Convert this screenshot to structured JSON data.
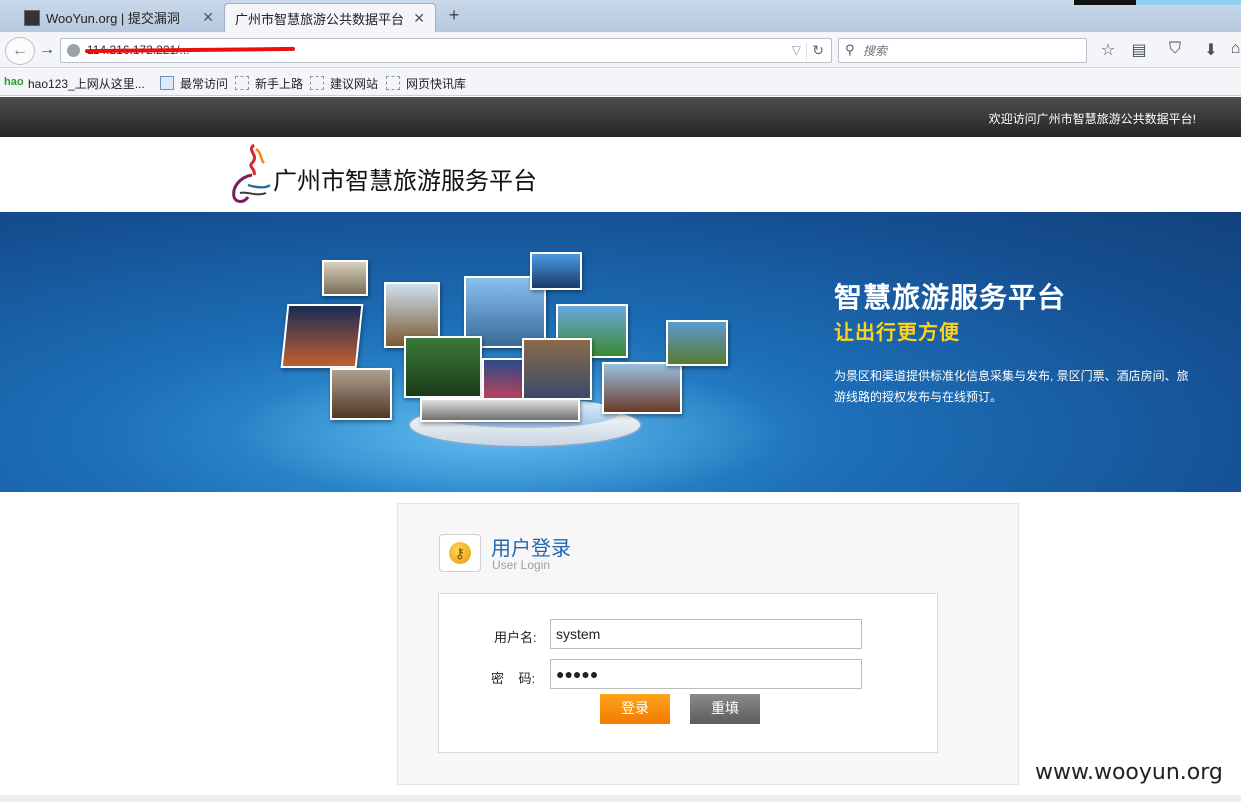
{
  "browser": {
    "tabs": [
      {
        "title": "WooYun.org | 提交漏洞",
        "active": false
      },
      {
        "title": "广州市智慧旅游公共数据平台",
        "active": true
      }
    ],
    "url": "114.216.172.221/...",
    "search_placeholder": "搜索",
    "bookmarks": [
      "hao123_上网从这里...",
      "最常访问",
      "新手上路",
      "建议网站",
      "网页快讯库"
    ]
  },
  "topbar": {
    "welcome": "欢迎访问广州市智慧旅游公共数据平台!"
  },
  "header": {
    "logo_text": "广州市智慧旅游服务平台"
  },
  "banner": {
    "title": "智慧旅游服务平台",
    "subtitle": "让出行更方便",
    "description": "为景区和渠道提供标准化信息采集与发布, 景区门票、酒店房间、旅游线路的授权发布与在线预订。"
  },
  "login": {
    "title": "用户登录",
    "subtitle": "User Login",
    "username_label": "用户名:",
    "password_label": "密    码:",
    "username_value": "system",
    "password_value": "●●●●●",
    "login_button": "登录",
    "reset_button": "重填"
  },
  "watermark": "www.wooyun.org",
  "colors": {
    "topbar": "#333333",
    "banner_blue": "#1d6fb8",
    "subtitle_yellow": "#ffd21c",
    "login_title_blue": "#1e67b3",
    "login_button_orange": "#f7901a",
    "reset_button_gray": "#6f6f6f"
  }
}
